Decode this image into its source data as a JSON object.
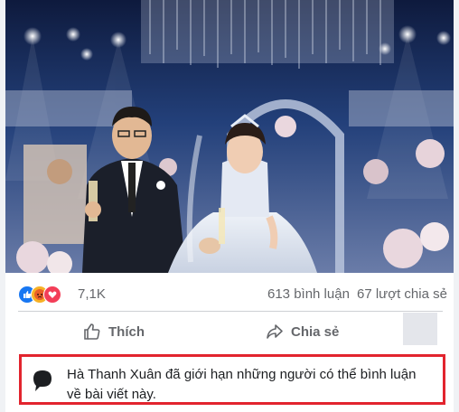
{
  "post": {
    "image_description_icon": "photo-icon",
    "reactions": {
      "icons": [
        "like-icon",
        "angry-icon",
        "love-icon"
      ],
      "count": "7,1K"
    },
    "comments_label": "613 bình luận",
    "shares_label": "67 lượt chia sẻ"
  },
  "actions": {
    "like_label": "Thích",
    "share_label": "Chia sẻ"
  },
  "notice": {
    "icon": "speech-bubble-icon",
    "text": "Hà Thanh Xuân đã giới hạn những người có thể bình luận về bài viết này."
  },
  "colors": {
    "like": "#1877f2",
    "angry": "#f7b125",
    "love": "#f33e58",
    "notice_border": "#e2242e",
    "muted_text": "#65676b"
  }
}
